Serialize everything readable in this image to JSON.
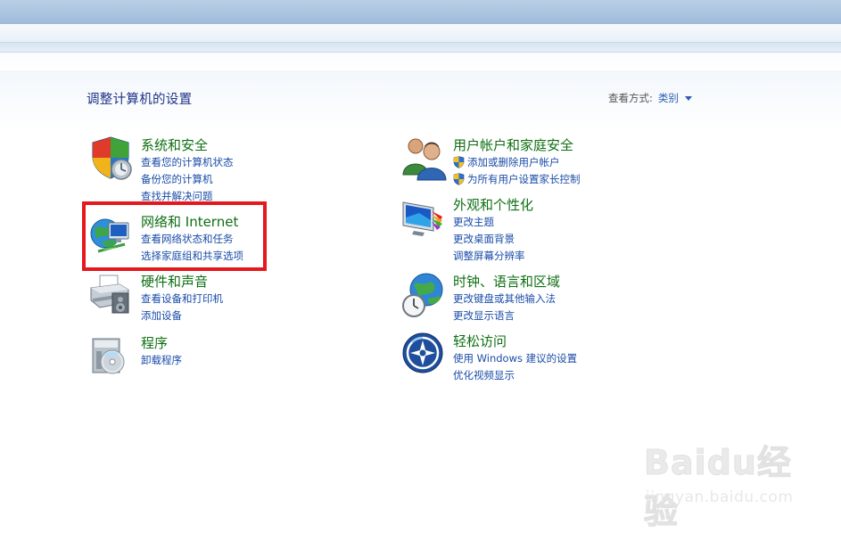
{
  "header": {
    "page_title": "调整计算机的设置",
    "view_by_label": "查看方式:",
    "view_by_value": "类别"
  },
  "categories": [
    {
      "title": "系统和安全",
      "icon": "shield-icon",
      "links": [
        "查看您的计算机状态",
        "备份您的计算机",
        "查找并解决问题"
      ]
    },
    {
      "title": "网络和 Internet",
      "icon": "network-globe-icon",
      "links": [
        "查看网络状态和任务",
        "选择家庭组和共享选项"
      ]
    },
    {
      "title": "硬件和声音",
      "icon": "printer-icon",
      "links": [
        "查看设备和打印机",
        "添加设备"
      ]
    },
    {
      "title": "程序",
      "icon": "programs-disc-icon",
      "links": [
        "卸载程序"
      ]
    },
    {
      "title": "用户帐户和家庭安全",
      "icon": "users-icon",
      "links": [
        "添加或删除用户帐户",
        "为所有用户设置家长控制"
      ]
    },
    {
      "title": "外观和个性化",
      "icon": "monitor-palette-icon",
      "links": [
        "更改主题",
        "更改桌面背景",
        "调整屏幕分辨率"
      ]
    },
    {
      "title": "时钟、语言和区域",
      "icon": "clock-globe-icon",
      "links": [
        "更改键盘或其他输入法",
        "更改显示语言"
      ]
    },
    {
      "title": "轻松访问",
      "icon": "ease-of-access-icon",
      "links": [
        "使用 Windows 建议的设置",
        "优化视频显示"
      ]
    }
  ],
  "watermark": {
    "logo": "Baidu经验",
    "url": "jingyan.baidu.com"
  },
  "colors": {
    "category_title": "#0e6f12",
    "link": "#1a4ca8",
    "highlight_box": "#e4181d"
  }
}
